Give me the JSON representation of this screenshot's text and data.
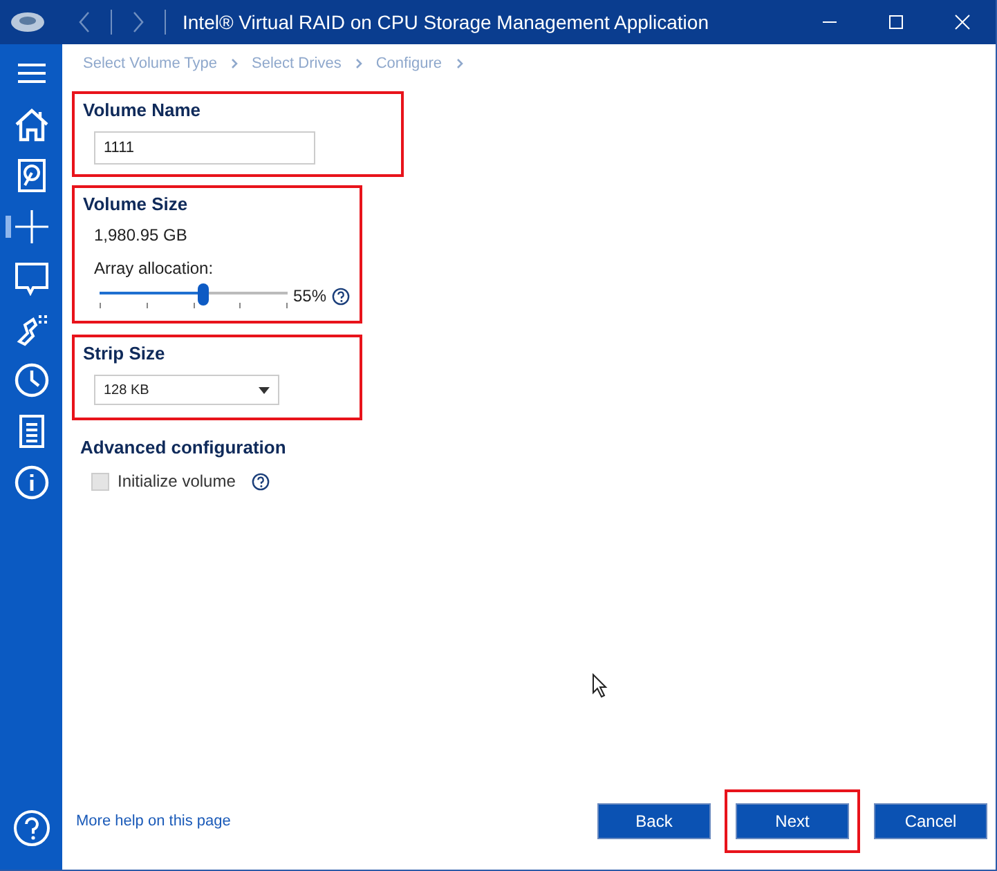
{
  "window": {
    "title": "Intel® Virtual RAID on CPU Storage Management Application"
  },
  "sidebar": {
    "items": [
      {
        "kind": "menu",
        "selected": false
      },
      {
        "kind": "home",
        "selected": false
      },
      {
        "kind": "disk",
        "selected": false
      },
      {
        "kind": "plus",
        "selected": true
      },
      {
        "kind": "screen",
        "selected": false
      },
      {
        "kind": "wrench",
        "selected": false
      },
      {
        "kind": "clock",
        "selected": false
      },
      {
        "kind": "document",
        "selected": false
      },
      {
        "kind": "info",
        "selected": false
      }
    ]
  },
  "breadcrumb": [
    "Select Volume Type",
    "Select Drives",
    "Configure"
  ],
  "volume_name": {
    "label": "Volume Name",
    "value": "1111",
    "highlighted": true
  },
  "volume_size": {
    "label": "Volume Size",
    "size": "1,980.95 GB",
    "slider_label": "Array allocation:",
    "level": 0.55,
    "reading": "55%",
    "highlighted": true
  },
  "strip_size": {
    "label": "Strip Size",
    "value": "128 KB",
    "highlighted": true
  },
  "advanced": {
    "label": "Advanced configuration",
    "initialize": {
      "label": "Initialize volume",
      "checked": false,
      "disabled": true
    }
  },
  "help_link": "More help on this page",
  "buttons": [
    {
      "label": "Back",
      "highlighted": false
    },
    {
      "label": "Next",
      "highlighted": true
    },
    {
      "label": "Cancel",
      "highlighted": false
    }
  ]
}
